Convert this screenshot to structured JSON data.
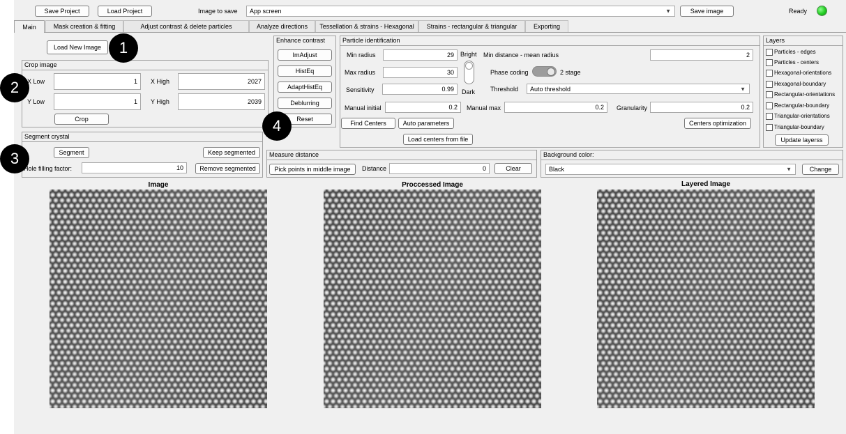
{
  "topbar": {
    "save_project": "Save Project",
    "load_project": "Load Project",
    "image_to_save_label": "Image to save",
    "image_to_save_value": "App screen",
    "save_image": "Save image",
    "status": "Ready",
    "status_color": "#22cc22"
  },
  "tabs": [
    {
      "label": "Main"
    },
    {
      "label": "Mask creation & fitting"
    },
    {
      "label": "Adjust contrast & delete particles"
    },
    {
      "label": "Analyze directions"
    },
    {
      "label": "Tessellation & strains - Hexagonal"
    },
    {
      "label": "Strains - rectangular & triangular"
    },
    {
      "label": "Exporting"
    }
  ],
  "load_new_image": "Load New Image",
  "crop": {
    "title": "Crop image",
    "x_low_label": "X Low",
    "x_low": "1",
    "x_high_label": "X High",
    "x_high": "2027",
    "y_low_label": "Y Low",
    "y_low": "1",
    "y_high_label": "Y High",
    "y_high": "2039",
    "crop_button": "Crop"
  },
  "segment": {
    "title": "Segment crystal",
    "segment_button": "Segment",
    "keep_button": "Keep segmented",
    "hole_label": "Hole filling factor:",
    "hole_value": "10",
    "remove_button": "Remove segmented"
  },
  "enhance": {
    "title": "Enhance contrast",
    "buttons": [
      "ImAdjust",
      "HistEq",
      "AdaptHistEq",
      "Deblurring",
      "Reset"
    ]
  },
  "particle": {
    "title": "Particle identification",
    "min_radius_label": "Min radius",
    "min_radius": "29",
    "max_radius_label": "Max radius",
    "max_radius": "30",
    "sensitivity_label": "Sensitivity",
    "sensitivity": "0.99",
    "bright_label": "Bright",
    "dark_label": "Dark",
    "min_distance_label": "Min distance - mean radius",
    "min_distance": "2",
    "phase_coding_label": "Phase coding",
    "phase_coding_state": "2 stage",
    "threshold_label": "Threshold",
    "threshold_value": "Auto threshold",
    "manual_initial_label": "Manual initial",
    "manual_initial": "0.2",
    "manual_max_label": "Manual max",
    "manual_max": "0.2",
    "granularity_label": "Granularity",
    "granularity": "0.2",
    "find_centers": "Find Centers",
    "auto_parameters": "Auto parameters",
    "centers_optimization": "Centers optimization",
    "load_centers": "Load centers from file"
  },
  "layers": {
    "title": "Layers",
    "items": [
      "Particles - edges",
      "Particles - centers",
      "Hexagonal-orientations",
      "Hexagonal-boundary",
      "Rectangular-orientations",
      "Rectangular-boundary",
      "Triangular-orientations",
      "Triangular-boundary"
    ],
    "update_button": "Update layerss"
  },
  "measure": {
    "title": "Measure distance",
    "pick_button": "Pick points in middle image",
    "distance_label": "Distance",
    "distance_value": "0",
    "clear_button": "Clear"
  },
  "background": {
    "title": "Background color:",
    "value": "Black",
    "change_button": "Change"
  },
  "images": {
    "image_title": "Image",
    "processed_title": "Proccessed Image",
    "layered_title": "Layered Image"
  },
  "badges": [
    "1",
    "2",
    "3",
    "4"
  ]
}
